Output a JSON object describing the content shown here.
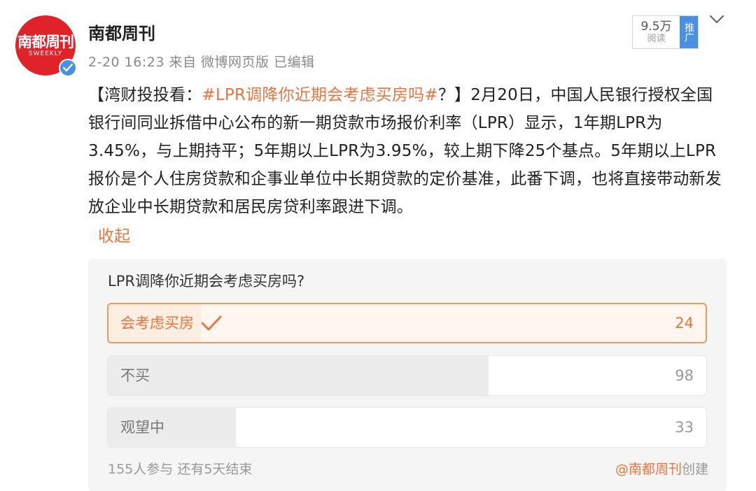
{
  "author": {
    "name": "南都周刊",
    "avatar_text": "南都周刊",
    "avatar_subtext": "SWEEKLY"
  },
  "meta": {
    "timestamp": "2-20 16:23",
    "source": "来自 微博网页版",
    "edited": "已编辑"
  },
  "stats": {
    "read_count": "9.5万",
    "read_label": "阅读",
    "promote_label": "推广"
  },
  "post": {
    "prefix": "【湾财投投看：",
    "topic": "#LPR调降你近期会考虑买房吗#",
    "after_topic": "？】",
    "body": "2月20日，中国人民银行授权全国银行间同业拆借中心公布的新一期贷款市场报价利率（LPR）显示，1年期LPR为3.45%，与上期持平；5年期以上LPR为3.95%，较上期下降25个基点。5年期以上LPR报价是个人住房贷款和企事业单位中长期贷款的定价基准，此番下调，也将直接带动新发放企业中长期贷款和居民房贷利率跟进下调。",
    "collapse_label": "收起"
  },
  "poll": {
    "question": "LPR调降你近期会考虑买房吗?",
    "options": [
      {
        "label": "会考虑买房",
        "count": "24",
        "selected": true
      },
      {
        "label": "不买",
        "count": "98",
        "selected": false
      },
      {
        "label": "观望中",
        "count": "33",
        "selected": false
      }
    ],
    "participants": "155人参与",
    "remaining": "还有5天结束",
    "creator": "@南都周刊",
    "creator_suffix": "创建"
  },
  "colors": {
    "accent": "#eb7340",
    "brand_red": "#e0232b",
    "verified_blue": "#4a90e2"
  }
}
